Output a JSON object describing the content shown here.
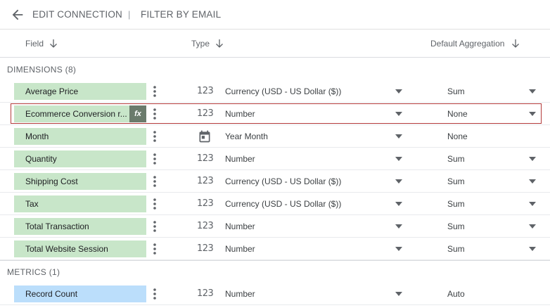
{
  "topbar": {
    "back_icon": "arrow-left-icon",
    "title": "EDIT CONNECTION",
    "separator": "|",
    "subtitle": "FILTER BY EMAIL"
  },
  "columns": {
    "field": "Field",
    "type": "Type",
    "aggregation": "Default Aggregation",
    "sort_icon": "arrow-down-icon"
  },
  "dimensions": {
    "label": "DIMENSIONS (8)",
    "rows": [
      {
        "name": "Average Price",
        "type_icon": "123",
        "type": "Currency (USD - US Dollar ($))",
        "agg": "Sum",
        "agg_dropdown": true
      },
      {
        "name": "Ecommerce Conversion r...",
        "type_icon": "123",
        "type": "Number",
        "agg": "None",
        "agg_dropdown": true,
        "fx": "fx",
        "selected": true
      },
      {
        "name": "Month",
        "type_icon": "calendar",
        "type": "Year Month",
        "agg": "None",
        "agg_dropdown": false
      },
      {
        "name": "Quantity",
        "type_icon": "123",
        "type": "Number",
        "agg": "Sum",
        "agg_dropdown": true
      },
      {
        "name": "Shipping Cost",
        "type_icon": "123",
        "type": "Currency (USD - US Dollar ($))",
        "agg": "Sum",
        "agg_dropdown": true
      },
      {
        "name": "Tax",
        "type_icon": "123",
        "type": "Currency (USD - US Dollar ($))",
        "agg": "Sum",
        "agg_dropdown": true
      },
      {
        "name": "Total Transaction",
        "type_icon": "123",
        "type": "Number",
        "agg": "Sum",
        "agg_dropdown": true
      },
      {
        "name": "Total Website Session",
        "type_icon": "123",
        "type": "Number",
        "agg": "Sum",
        "agg_dropdown": true
      }
    ]
  },
  "metrics": {
    "label": "METRICS (1)",
    "rows": [
      {
        "name": "Record Count",
        "type_icon": "123",
        "type": "Number",
        "agg": "Auto",
        "agg_dropdown": false
      }
    ]
  },
  "colors": {
    "dimension_chip": "#c8e6c9",
    "metric_chip": "#bbdefb",
    "selected_border": "#b33a3a",
    "fx_badge": "#6b7b6c"
  }
}
